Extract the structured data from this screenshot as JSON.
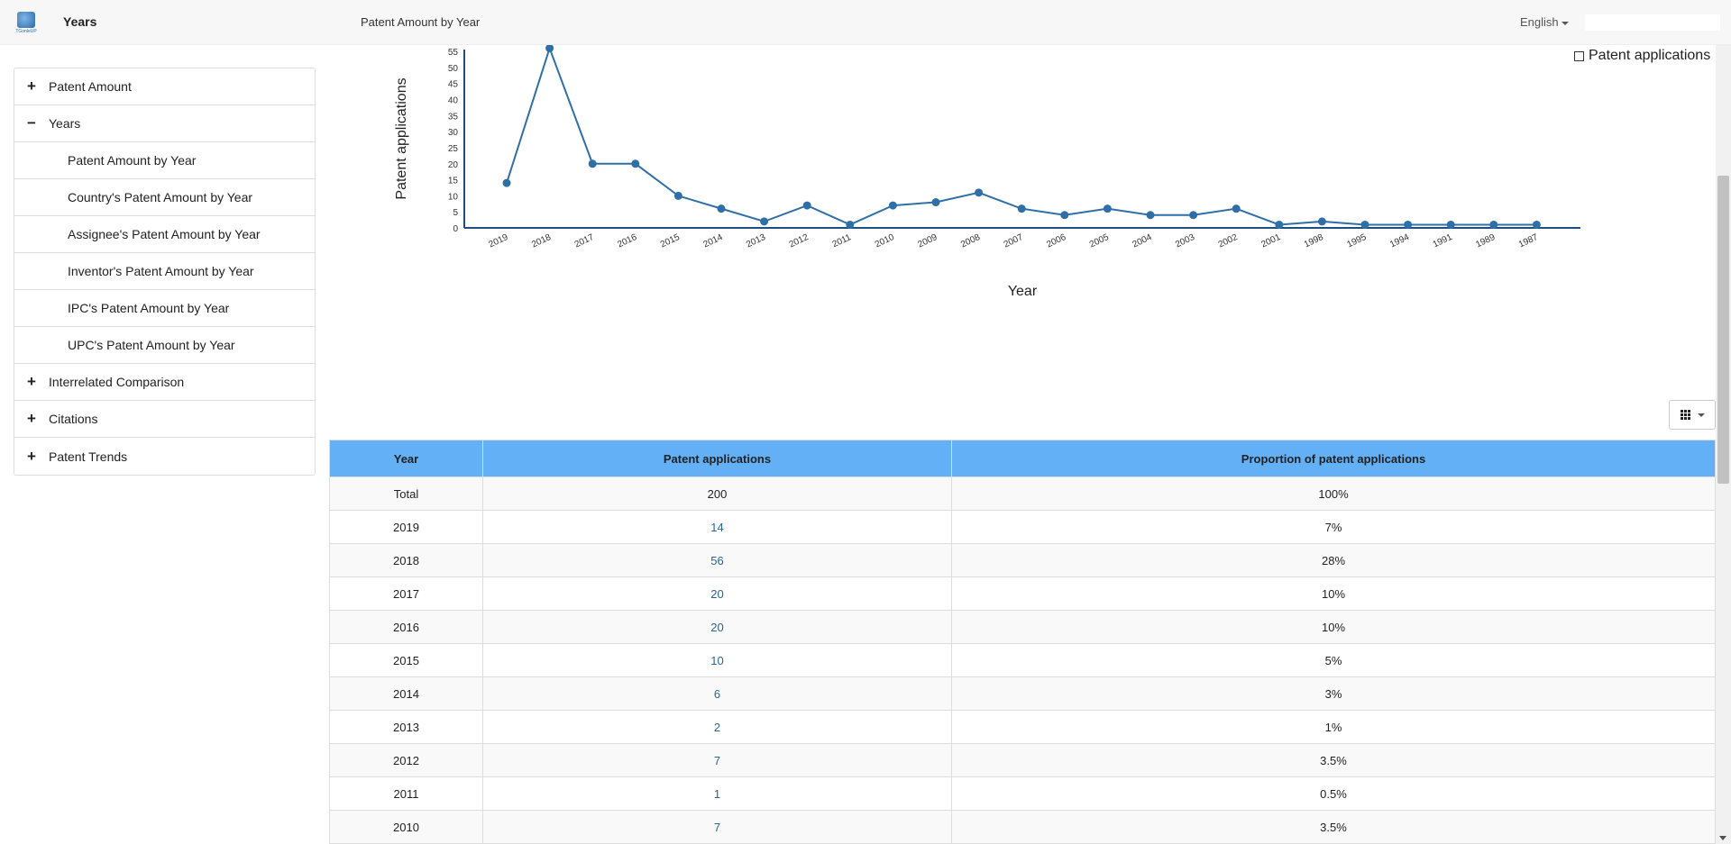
{
  "header": {
    "logo_text": "TGonleUP",
    "title": "Years",
    "subtitle": "Patent Amount by Year",
    "language": "English"
  },
  "sidebar": {
    "items": [
      {
        "label": "Patent Amount",
        "toggle": "+",
        "level": 0
      },
      {
        "label": "Years",
        "toggle": "−",
        "level": 0
      },
      {
        "label": "Patent Amount by Year",
        "toggle": "",
        "level": 1
      },
      {
        "label": "Country's Patent Amount by Year",
        "toggle": "",
        "level": 1
      },
      {
        "label": "Assignee's Patent Amount by Year",
        "toggle": "",
        "level": 1
      },
      {
        "label": "Inventor's Patent Amount by Year",
        "toggle": "",
        "level": 1
      },
      {
        "label": "IPC's Patent Amount by Year",
        "toggle": "",
        "level": 1
      },
      {
        "label": "UPC's Patent Amount by Year",
        "toggle": "",
        "level": 1
      },
      {
        "label": "Interrelated Comparison",
        "toggle": "+",
        "level": 0
      },
      {
        "label": "Citations",
        "toggle": "+",
        "level": 0
      },
      {
        "label": "Patent Trends",
        "toggle": "+",
        "level": 0
      }
    ]
  },
  "chart_data": {
    "type": "line",
    "categories": [
      "2019",
      "2018",
      "2017",
      "2016",
      "2015",
      "2014",
      "2013",
      "2012",
      "2011",
      "2010",
      "2009",
      "2008",
      "2007",
      "2006",
      "2005",
      "2004",
      "2003",
      "2002",
      "2001",
      "1998",
      "1995",
      "1994",
      "1991",
      "1989",
      "1987"
    ],
    "series": [
      {
        "name": "Patent applications",
        "values": [
          14,
          56,
          20,
          20,
          10,
          6,
          2,
          7,
          1,
          7,
          8,
          11,
          6,
          4,
          6,
          4,
          4,
          6,
          1,
          2,
          1,
          1,
          1,
          1,
          1
        ]
      }
    ],
    "yticks": [
      0,
      5,
      10,
      15,
      20,
      25,
      30,
      35,
      40,
      45,
      50,
      55
    ],
    "ylim": [
      0,
      57
    ],
    "xlabel": "Year",
    "ylabel": "Patent applications",
    "color": "#2f6fa8",
    "legend_placement": "top-right",
    "legend_label": "Patent applications"
  },
  "table": {
    "headers": [
      "Year",
      "Patent applications",
      "Proportion of patent applications"
    ],
    "rows": [
      [
        "Total",
        "200",
        "100%"
      ],
      [
        "2019",
        "14",
        "7%"
      ],
      [
        "2018",
        "56",
        "28%"
      ],
      [
        "2017",
        "20",
        "10%"
      ],
      [
        "2016",
        "20",
        "10%"
      ],
      [
        "2015",
        "10",
        "5%"
      ],
      [
        "2014",
        "6",
        "3%"
      ],
      [
        "2013",
        "2",
        "1%"
      ],
      [
        "2012",
        "7",
        "3.5%"
      ],
      [
        "2011",
        "1",
        "0.5%"
      ],
      [
        "2010",
        "7",
        "3.5%"
      ]
    ]
  }
}
